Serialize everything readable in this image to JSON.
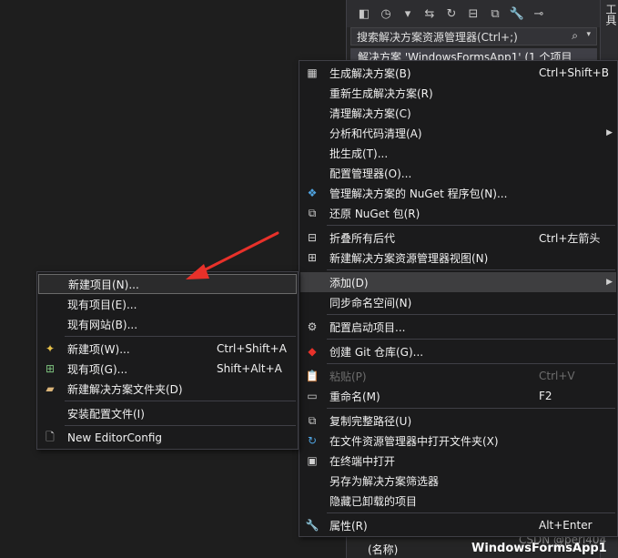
{
  "solution_explorer": {
    "search_text": "搜索解决方案资源管理器(Ctrl+;)",
    "root_item": "解决方案 'WindowsFormsApp1' (1 个项目",
    "side_tab": "工具",
    "property_label": "(名称)",
    "property_value": "WindowsFormsApp1"
  },
  "watermark": "CSDN @peri404",
  "main_menu": {
    "items": [
      {
        "label": "生成解决方案(B)",
        "shortcut": "Ctrl+Shift+B",
        "icon": "build-icon"
      },
      {
        "label": "重新生成解决方案(R)",
        "shortcut": ""
      },
      {
        "label": "清理解决方案(C)",
        "shortcut": ""
      },
      {
        "label": "分析和代码清理(A)",
        "shortcut": "",
        "submenu": true
      },
      {
        "label": "批生成(T)...",
        "shortcut": ""
      },
      {
        "label": "配置管理器(O)...",
        "shortcut": ""
      },
      {
        "label": "管理解决方案的 NuGet 程序包(N)...",
        "shortcut": "",
        "icon": "nuget-icon"
      },
      {
        "label": "还原 NuGet 包(R)",
        "shortcut": "",
        "icon": "restore-icon"
      },
      {
        "label": "折叠所有后代",
        "shortcut": "Ctrl+左箭头",
        "icon": "collapse-icon"
      },
      {
        "label": "新建解决方案资源管理器视图(N)",
        "shortcut": "",
        "icon": "new-view-icon"
      },
      {
        "label": "添加(D)",
        "shortcut": "",
        "submenu": true
      },
      {
        "label": "同步命名空间(N)",
        "shortcut": ""
      },
      {
        "label": "配置启动项目...",
        "shortcut": "",
        "icon": "gear-icon"
      },
      {
        "label": "创建 Git 仓库(G)...",
        "shortcut": "",
        "icon": "git-icon"
      },
      {
        "label": "粘贴(P)",
        "shortcut": "Ctrl+V",
        "disabled": true,
        "icon": "paste-icon"
      },
      {
        "label": "重命名(M)",
        "shortcut": "F2",
        "icon": "rename-icon"
      },
      {
        "label": "复制完整路径(U)",
        "shortcut": "",
        "icon": "copy-icon"
      },
      {
        "label": "在文件资源管理器中打开文件夹(X)",
        "shortcut": "",
        "icon": "refresh-icon"
      },
      {
        "label": "在终端中打开",
        "shortcut": "",
        "icon": "terminal-icon"
      },
      {
        "label": "另存为解决方案筛选器",
        "shortcut": ""
      },
      {
        "label": "隐藏已卸载的项目",
        "shortcut": ""
      },
      {
        "label": "属性(R)",
        "shortcut": "Alt+Enter",
        "icon": "wrench-icon"
      }
    ]
  },
  "add_submenu": {
    "items": [
      {
        "label": "新建项目(N)...",
        "shortcut": ""
      },
      {
        "label": "现有项目(E)...",
        "shortcut": ""
      },
      {
        "label": "现有网站(B)...",
        "shortcut": ""
      },
      {
        "label": "新建项(W)...",
        "shortcut": "Ctrl+Shift+A",
        "icon": "new-item-icon"
      },
      {
        "label": "现有项(G)...",
        "shortcut": "Shift+Alt+A",
        "icon": "existing-item-icon"
      },
      {
        "label": "新建解决方案文件夹(D)",
        "shortcut": "",
        "icon": "folder-icon"
      },
      {
        "label": "安装配置文件(I)",
        "shortcut": ""
      },
      {
        "label": "New EditorConfig",
        "shortcut": "",
        "icon": "file-icon"
      }
    ]
  },
  "colors": {
    "accent_arrow": "#e8312a",
    "menu_bg": "#1b1b1c",
    "hover_bg": "#3e3e40"
  }
}
